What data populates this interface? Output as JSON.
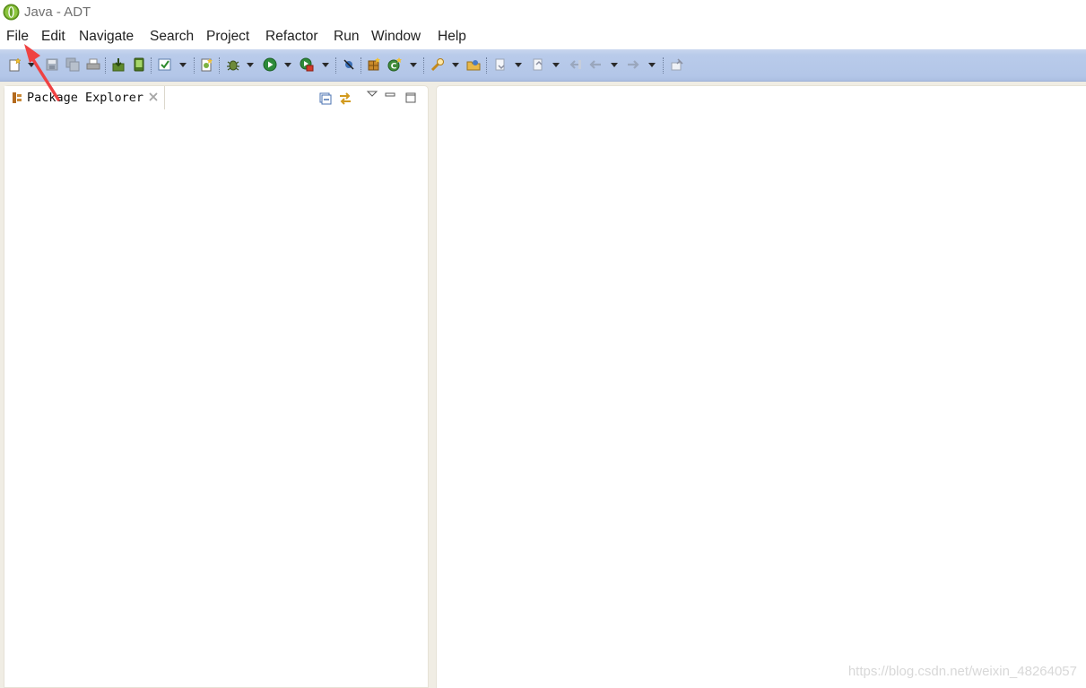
{
  "window": {
    "title": "Java - ADT",
    "icon": "adt-app-icon"
  },
  "menu": {
    "items": [
      {
        "label": "File"
      },
      {
        "label": "Edit"
      },
      {
        "label": "Navigate"
      },
      {
        "label": "Search"
      },
      {
        "label": "Project"
      },
      {
        "label": "Refactor"
      },
      {
        "label": "Run"
      },
      {
        "label": "Window"
      },
      {
        "label": "Help"
      }
    ]
  },
  "toolbar": {
    "icons": [
      "new-icon",
      "save-icon",
      "save-all-icon",
      "print-icon",
      "sdk-manager-icon",
      "avd-manager-icon",
      "lint-check-icon",
      "new-android-project-icon",
      "debug-icon",
      "run-icon",
      "external-tools-icon",
      "skip-breakpoints-icon",
      "new-java-package-icon",
      "new-java-class-icon",
      "search-icon",
      "open-type-icon",
      "next-annotation-icon",
      "prev-annotation-icon",
      "last-edit-location-icon",
      "back-icon",
      "forward-icon",
      "pin-editor-icon"
    ]
  },
  "left_view": {
    "tab_label": "Package Explorer",
    "tools": [
      "collapse-all-icon",
      "link-with-editor-icon",
      "view-menu-icon",
      "minimize-icon",
      "maximize-icon"
    ]
  },
  "watermark": "https://blog.csdn.net/weixin_48264057",
  "colors": {
    "toolbar_bg": "#b3c6e8",
    "window_bg": "#f0ede4",
    "annotation_arrow": "#ef4242"
  }
}
